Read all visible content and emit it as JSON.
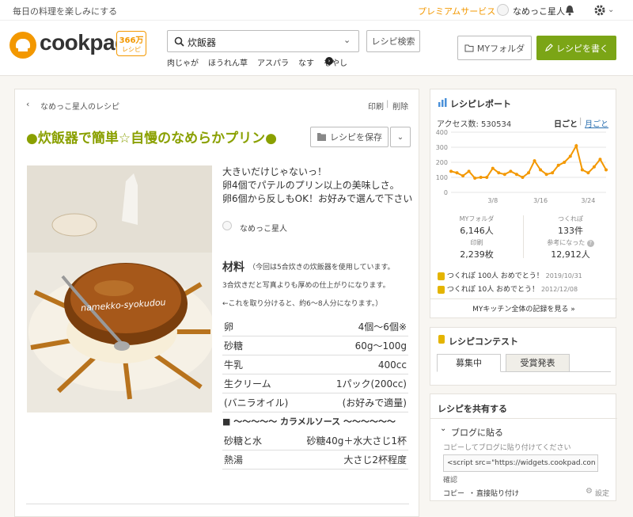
{
  "topbar": {
    "tagline": "毎日の料理を楽しみにする",
    "premium": "プレミアムサービス",
    "username": "なめっこ星人"
  },
  "header": {
    "logo_text": "cookpad",
    "badge_line1": "366万",
    "badge_line2": "レシピ",
    "search_value": "炊飯器",
    "search_button": "レシピ検索",
    "suggestions": [
      "肉じゃが",
      "ほうれん草",
      "アスパラ",
      "なす",
      "もやし"
    ],
    "folder_button": "MYフォルダ",
    "write_button": "レシピを書く"
  },
  "recipe": {
    "breadcrumb": "なめっこ星人のレシピ",
    "print": "印刷",
    "delete": "削除",
    "title": "●炊飯器で簡単☆自慢のなめらかプリン●",
    "save_button": "レシピを保存",
    "description": [
      "大きいだけじゃないっ！",
      "卵4個でパテルのプリン以上の美味しさ。",
      "卵6個から反しもOK！お好みで選んで下さい"
    ],
    "author": "なめっこ星人",
    "photo_watermark": "namekko-syokudou",
    "ingredients_heading": "材料",
    "ingredients_note": [
      "（今回は5合炊きの炊飯器を使用しています。",
      "3合炊きだと写真よりも厚めの仕上がりになります。",
      "←これを取り分けると、約6～8人分になります。）"
    ],
    "ingredients": [
      {
        "name": "卵",
        "qty": "4個～6個※"
      },
      {
        "name": "砂糖",
        "qty": "60g～100g"
      },
      {
        "name": "牛乳",
        "qty": "400cc"
      },
      {
        "name": "生クリーム",
        "qty": "1パック(200cc)"
      },
      {
        "name": "(バニラオイル)",
        "qty": "(お好みで適量)"
      }
    ],
    "caramel_heading": "■ ～～～～～ カラメルソース ～～～～～～",
    "caramel": [
      {
        "name": "砂糖と水",
        "qty": "砂糖40g＋水大さじ1杯"
      },
      {
        "name": "熱湯",
        "qty": "大さじ2杯程度"
      }
    ]
  },
  "report": {
    "title": "レシピレポート",
    "access_label": "アクセス数: 530534",
    "tab_daily": "日ごと",
    "tab_monthly": "月ごと",
    "chart_data": {
      "type": "line",
      "title": "",
      "x_ticks": [
        "3/8",
        "3/16",
        "3/24"
      ],
      "y_ticks": [
        0,
        100,
        200,
        300,
        400
      ],
      "ylim": [
        0,
        400
      ],
      "values": [
        140,
        130,
        110,
        140,
        95,
        100,
        100,
        160,
        130,
        120,
        140,
        120,
        100,
        130,
        210,
        150,
        120,
        130,
        180,
        200,
        240,
        310,
        150,
        130,
        170,
        220,
        150
      ],
      "color": "#f39800"
    },
    "stats": [
      {
        "label": "MYフォルダ",
        "value": "6,146人"
      },
      {
        "label": "つくれぽ",
        "value": "133件"
      },
      {
        "label": "印刷",
        "value": "2,239枚"
      },
      {
        "label": "参考になった",
        "value": "12,912人"
      }
    ],
    "achievements": [
      {
        "text": "つくれぽ 100人 おめでとう！",
        "date": "2019/10/31"
      },
      {
        "text": "つくれぽ 10人 おめでとう！",
        "date": "2012/12/08"
      }
    ],
    "kitchen_link": "MYキッチン全体の記録を見る »"
  },
  "contest": {
    "title": "レシピコンテスト",
    "tab_open": "募集中",
    "tab_results": "受賞発表"
  },
  "share": {
    "title": "レシピを共有する",
    "blog_label": "ブログに貼る",
    "copy_hint": "コピーしてブログに貼り付けてください",
    "code_value": "<script src=\"https://widgets.cookpad.con",
    "confirm": "確認",
    "copy": "コピー",
    "direct_paste": "直接貼り付け",
    "settings": "設定"
  },
  "colors": {
    "accent_green": "#8aa000",
    "brand_orange": "#f39800",
    "write_button": "#7ba516"
  }
}
